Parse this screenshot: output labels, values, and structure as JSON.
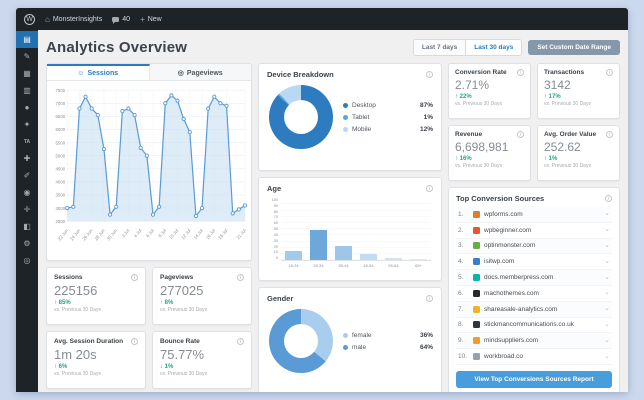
{
  "admin_bar": {
    "wp_logo": "W",
    "site_name": "MonsterInsights",
    "comment_count": "40",
    "new_label": "New"
  },
  "sidebar": {
    "items": [
      {
        "name": "dashboard-icon",
        "glyph": "▤",
        "active": true
      },
      {
        "name": "posts-icon",
        "glyph": "✎",
        "active": false
      },
      {
        "name": "media-icon",
        "glyph": "▦",
        "active": false
      },
      {
        "name": "pages-icon",
        "glyph": "▥",
        "active": false
      },
      {
        "name": "comments-icon",
        "glyph": "●",
        "active": false
      },
      {
        "name": "appearance-icon",
        "glyph": "✦",
        "active": false
      },
      {
        "name": "ta-plugin-icon",
        "glyph": "TA",
        "active": false,
        "tiny": true
      },
      {
        "name": "plugins-icon",
        "glyph": "✚",
        "active": false
      },
      {
        "name": "brush-icon",
        "glyph": "✐",
        "active": false
      },
      {
        "name": "users-icon",
        "glyph": "◉",
        "active": false
      },
      {
        "name": "tools-icon",
        "glyph": "✛",
        "active": false
      },
      {
        "name": "analytics-icon",
        "glyph": "◧",
        "active": false
      },
      {
        "name": "settings-icon",
        "glyph": "⚙",
        "active": false
      },
      {
        "name": "collapse-icon",
        "glyph": "◎",
        "active": false
      }
    ]
  },
  "header": {
    "title": "Analytics Overview",
    "range_buttons": [
      {
        "label": "Last 7 days",
        "active": false
      },
      {
        "label": "Last 30 days",
        "active": true
      }
    ],
    "custom_range_label": "Set Custom Date Range"
  },
  "tabs": [
    {
      "label": "Sessions",
      "icon": "☺"
    },
    {
      "label": "Pageviews",
      "icon": "◎"
    }
  ],
  "stats_left": [
    {
      "label": "Sessions",
      "value": "225156",
      "delta": "↑ 85%",
      "sub": "vs. Previous 30 Days"
    },
    {
      "label": "Pageviews",
      "value": "277025",
      "delta": "↑ 8%",
      "sub": "vs. Previous 30 Days"
    },
    {
      "label": "Avg. Session Duration",
      "value": "1m 20s",
      "delta": "↑ 6%",
      "sub": "vs. Previous 30 Days"
    },
    {
      "label": "Bounce Rate",
      "value": "75.77%",
      "delta": "↓ 1%",
      "sub": "vs. Previous 30 Days"
    }
  ],
  "stats_right": [
    {
      "label": "Conversion Rate",
      "value": "2.71%",
      "delta": "↑ 22%",
      "sub": "vs. Previous 30 Days"
    },
    {
      "label": "Transactions",
      "value": "3142",
      "delta": "↑ 17%",
      "sub": "vs. Previous 30 Days"
    },
    {
      "label": "Revenue",
      "value": "6,698,981",
      "delta": "↑ 16%",
      "sub": "vs. Previous 30 Days"
    },
    {
      "label": "Avg. Order Value",
      "value": "252.62",
      "delta": "↑ 1%",
      "sub": "vs. Previous 30 Days"
    }
  ],
  "device": {
    "title": "Device Breakdown"
  },
  "age": {
    "title": "Age"
  },
  "gender": {
    "title": "Gender"
  },
  "sources": {
    "title": "Top Conversion Sources",
    "items": [
      {
        "rank": "1.",
        "domain": "wpforms.com",
        "color": "#e17c2f"
      },
      {
        "rank": "2.",
        "domain": "wpbeginner.com",
        "color": "#e8562d"
      },
      {
        "rank": "3.",
        "domain": "optinmonster.com",
        "color": "#6bac43"
      },
      {
        "rank": "4.",
        "domain": "isitwp.com",
        "color": "#3a7fc8"
      },
      {
        "rank": "5.",
        "domain": "docs.memberpress.com",
        "color": "#0ab4aa"
      },
      {
        "rank": "6.",
        "domain": "machothemes.com",
        "color": "#26292e"
      },
      {
        "rank": "7.",
        "domain": "shareasale-analytics.com",
        "color": "#f0b429"
      },
      {
        "rank": "8.",
        "domain": "stickmancommunications.co.uk",
        "color": "#2f3640"
      },
      {
        "rank": "9.",
        "domain": "mindsuppliers.com",
        "color": "#f39c2c"
      },
      {
        "rank": "10.",
        "domain": "workbroad.co",
        "color": "#98a2ad"
      }
    ],
    "button_label": "View Top Conversions Sources Report"
  },
  "chart_data": [
    {
      "type": "area",
      "title": "Sessions",
      "x": [
        "22 Jun",
        "23 Jun",
        "24 Jun",
        "25 Jun",
        "26 Jun",
        "27 Jun",
        "28 Jun",
        "29 Jun",
        "30 Jun",
        "1 Jul",
        "2 Jul",
        "3 Jul",
        "4 Jul",
        "5 Jul",
        "6 Jul",
        "7 Jul",
        "8 Jul",
        "9 Jul",
        "10 Jul",
        "11 Jul",
        "12 Jul",
        "13 Jul",
        "14 Jul",
        "15 Jul",
        "16 Jul",
        "17 Jul",
        "18 Jul",
        "19 Jul",
        "20 Jul",
        "21 Jul"
      ],
      "values": [
        3000,
        3050,
        6800,
        7250,
        6800,
        6550,
        5250,
        2750,
        3050,
        6700,
        6800,
        6550,
        5300,
        5000,
        2750,
        3050,
        7000,
        7300,
        7100,
        6400,
        5900,
        2700,
        3000,
        6800,
        7250,
        7000,
        6900,
        2800,
        2950,
        3100
      ],
      "visible_tick_indices": [
        0,
        2,
        4,
        6,
        8,
        10,
        12,
        14,
        16,
        18,
        20,
        22,
        24,
        26,
        29
      ],
      "ylim": [
        2500,
        7500
      ],
      "ytick_step": 500,
      "grid": true,
      "line_color": "#5b9bd5",
      "fill_color": "#cde2f5"
    },
    {
      "type": "pie",
      "title": "Device Breakdown",
      "labels": [
        "Desktop",
        "Tablet",
        "Mobile"
      ],
      "values": [
        87,
        1,
        12
      ],
      "value_labels": [
        "87%",
        "1%",
        "12%"
      ],
      "colors": [
        "#2e7cc0",
        "#57a4de",
        "#b9d8f4"
      ],
      "legend_position": "right"
    },
    {
      "type": "bar",
      "title": "Age",
      "categories": [
        "18-24",
        "25-34",
        "35-44",
        "45-54",
        "55-64",
        "65+"
      ],
      "values": [
        15,
        48,
        22,
        9,
        4,
        2
      ],
      "ylim": [
        0,
        100
      ],
      "ytick_step": 10,
      "grid": true,
      "bar_colors": [
        "#a3cae9",
        "#6da8db",
        "#9ec6e8",
        "#c2dcf2",
        "#cde2f4",
        "#d9eaf8"
      ]
    },
    {
      "type": "pie",
      "title": "Gender",
      "labels": [
        "female",
        "male"
      ],
      "values": [
        36,
        64
      ],
      "value_labels": [
        "36%",
        "64%"
      ],
      "colors": [
        "#a9cdec",
        "#5b9bd5"
      ],
      "legend_position": "right"
    }
  ],
  "colors": {
    "accent_blue": "#2b7bc0",
    "button_blue": "#4a9ddc",
    "delta_green": "#26a583",
    "admin_dark": "#1d2327",
    "sidebar_active": "#2271b1",
    "page_bg": "#f0f0f1",
    "frame_bg": "#cbd8ed"
  }
}
